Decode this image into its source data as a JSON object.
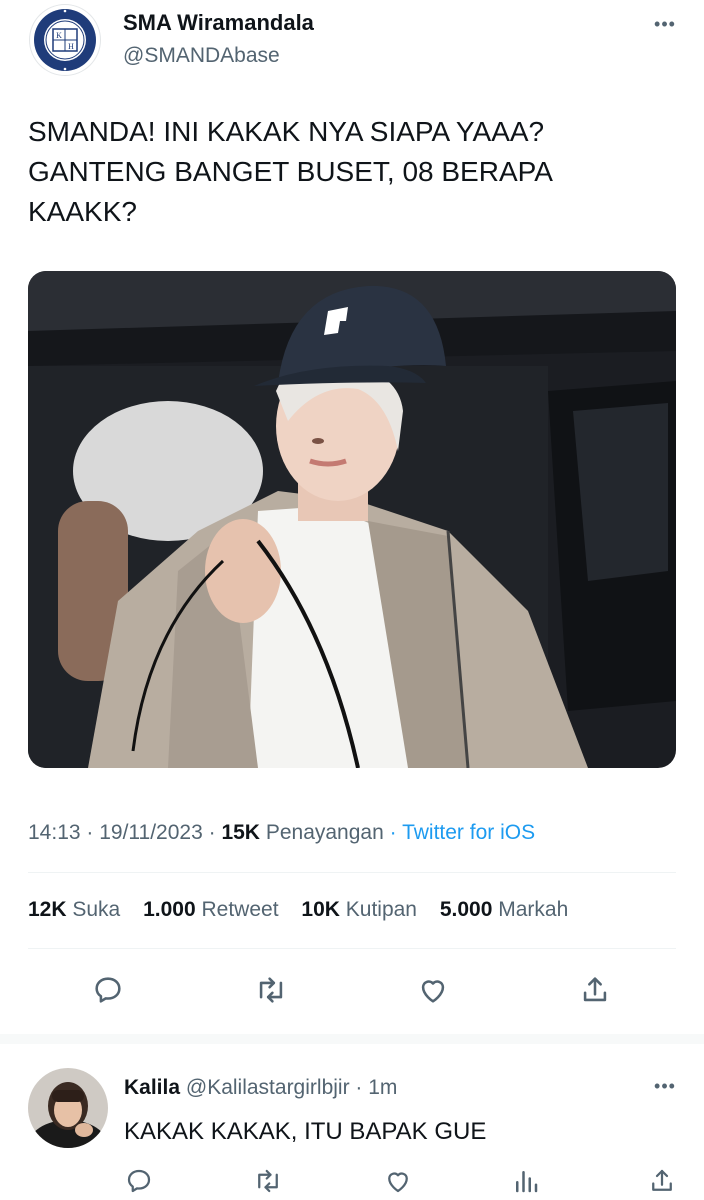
{
  "tweet": {
    "display_name": "SMA Wiramandala",
    "handle": "@SMANDAbase",
    "text": "SMANDA! INI KAKAK NYA SIAPA YAAA? GANTENG BANGET BUSET, 08 BERAPA KAAKK?",
    "time": "14:13",
    "date": "19/11/2023",
    "views_count": "15K",
    "views_label": "Penayangan",
    "source": "Twitter for iOS",
    "likes_count": "12K",
    "likes_label": "Suka",
    "retweets_count": "1.000",
    "retweets_label": "Retweet",
    "quotes_count": "10K",
    "quotes_label": "Kutipan",
    "bookmarks_count": "5.000",
    "bookmarks_label": "Markah"
  },
  "avatar_logo_letters": [
    "K",
    "H"
  ],
  "reply": {
    "display_name": "Kalila",
    "handle": "@Kalilastargirlbjir",
    "time": "1m",
    "text": "KAKAK KAKAK, ITU BAPAK GUE"
  },
  "colors": {
    "link": "#1d9bf0",
    "secondary_text": "#536471",
    "primary_text": "#0f1419",
    "logo_navy": "#1f3c7a"
  },
  "icons": [
    "more-icon",
    "reply-icon",
    "retweet-icon",
    "like-icon",
    "share-icon",
    "views-icon"
  ]
}
